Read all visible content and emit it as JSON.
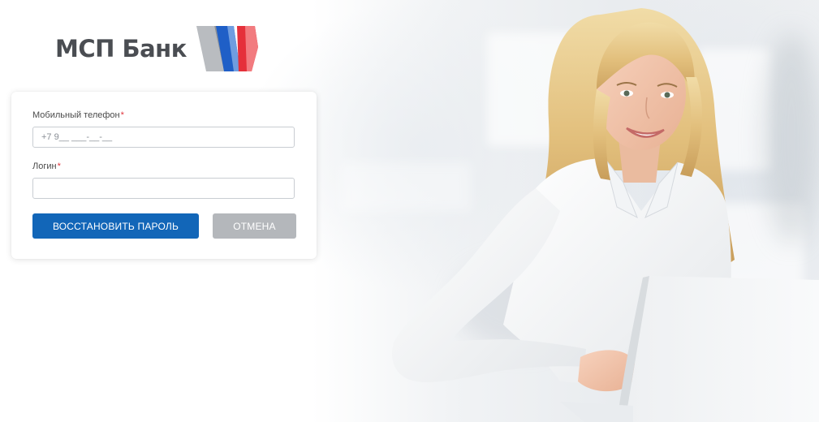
{
  "brand": {
    "name": "МСП Банк",
    "colors": {
      "gray": "#9ea1a6",
      "blue": "#1f5fc7",
      "red": "#e5303a",
      "primary_button": "#1266b8",
      "secondary_button": "#b4b7bb",
      "required_mark": "#e0353d"
    }
  },
  "form": {
    "phone": {
      "label": "Мобильный телефон",
      "required_mark": "*",
      "placeholder": "+7 9__ ___-__-__",
      "value": ""
    },
    "login": {
      "label": "Логин",
      "required_mark": "*",
      "placeholder": "",
      "value": ""
    },
    "buttons": {
      "restore_label": "ВОССТАНОВИТЬ ПАРОЛЬ",
      "cancel_label": "ОТМЕНА"
    }
  },
  "illustration": {
    "subject": "smiling-woman-with-laptop"
  }
}
